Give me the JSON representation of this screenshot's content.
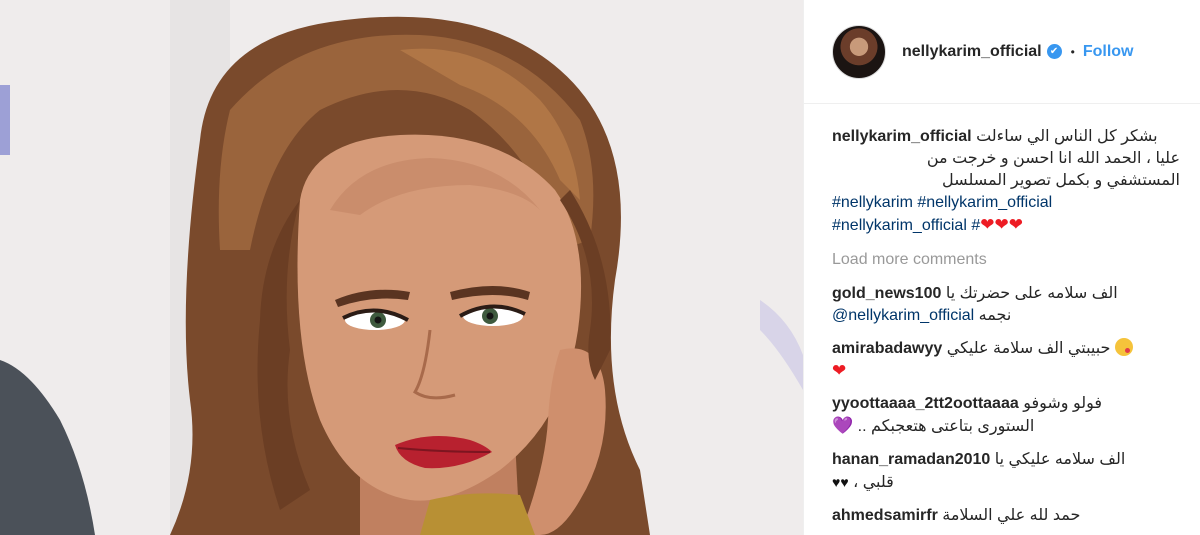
{
  "header": {
    "username": "nellykarim_official",
    "verified_mark": "✔",
    "separator": "•",
    "follow_label": "Follow"
  },
  "caption": {
    "username": "nellykarim_official",
    "lines": [
      "بشكر كل الناس الي ساءلت",
      "عليا ، الحمد الله انا احسن و خرجت من",
      "المستشفي و بكمل تصوير المسلسل"
    ],
    "hashtag_line_1": "#nellykarim #nellykarim_official",
    "hashtag_line_2": "#nellykarim_official #",
    "hearts": "❤❤❤"
  },
  "load_more_label": "Load more comments",
  "comments": [
    {
      "username": "gold_news100",
      "text_1": "الف سلامه على حضرتك يا",
      "mention": "@nellykarim_official",
      "text_2": "نجمه"
    },
    {
      "username": "amirabadawyy",
      "text_1": "حبيبتي الف سلامة عليكي",
      "heart": "❤"
    },
    {
      "username": "yyoottaaaa_2tt2oottaaaa",
      "text_1": "فولو وشوفو",
      "text_2": "الستورى بتاعتى هتعجبكم ..",
      "heart": "💜"
    },
    {
      "username": "hanan_ramadan2010",
      "text_1": "الف سلامه عليكي يا",
      "text_2": "قلبي ،",
      "hearts": "♥♥"
    },
    {
      "username": "ahmedsamirfr",
      "text_1": "حمد لله علي السلامة"
    }
  ],
  "colors": {
    "link_blue": "#3897f0",
    "hashtag_blue": "#003569",
    "muted_gray": "#999999",
    "heart_red": "#ed1c24"
  },
  "icons": [
    "verified-badge-icon",
    "red-heart-icon",
    "purple-heart-icon",
    "black-heart-icon",
    "kiss-face-emoji-icon"
  ]
}
